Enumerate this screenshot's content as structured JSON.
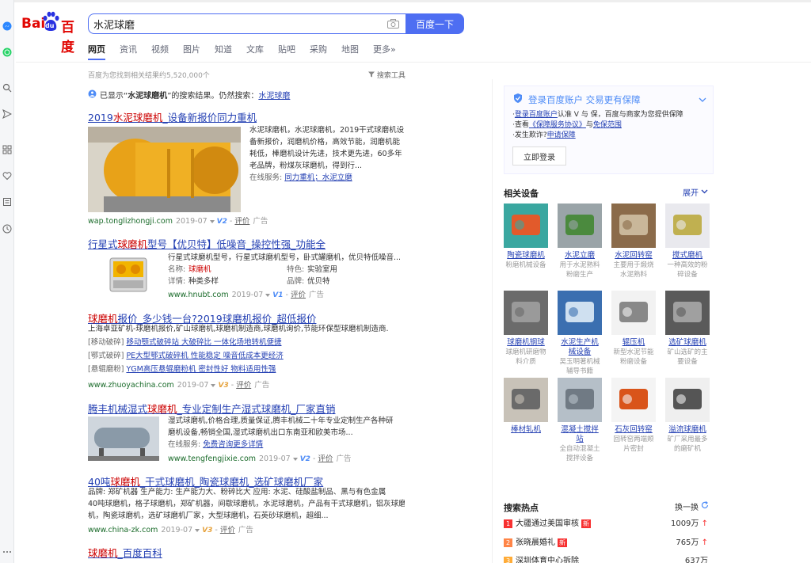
{
  "search": {
    "query": "水泥球磨",
    "button": "百度一下"
  },
  "logo": {
    "left": "Bai",
    "right": "百度",
    "paw": "du"
  },
  "tabs": [
    {
      "label": "网页",
      "active": true
    },
    {
      "label": "资讯"
    },
    {
      "label": "视频"
    },
    {
      "label": "图片"
    },
    {
      "label": "知道"
    },
    {
      "label": "文库"
    },
    {
      "label": "贴吧"
    },
    {
      "label": "采购"
    },
    {
      "label": "地图"
    },
    {
      "label": "更多»"
    }
  ],
  "result_count": "百度为您找到相关结果约5,520,000个",
  "search_tools": "搜索工具",
  "showing": {
    "prefix": "已显示“",
    "bold": "水泥球磨机",
    "mid": "”的搜索结果。仍然搜索：",
    "link": "水泥球磨"
  },
  "results": [
    {
      "title_pre": "2019",
      "title_red": "水泥球磨机",
      "title_post": "_设备新报价同力重机",
      "lines": [
        "水泥球磨机，水泥球磨机，2019干式球磨机设",
        "备新报价，润磨机价格，高效节能，润磨机能",
        "耗低，棒磨机设计先进，技术更先进，60多年",
        "老品牌，粉煤灰球磨机，得到行..."
      ],
      "service_label": "在线服务:",
      "service_link": "同力重机；水泥立磨",
      "url": "wap.tonglizhongji.com",
      "date": "2019-07",
      "v": "V2",
      "rating": "评价",
      "ad": "广告"
    },
    {
      "title_pre": "行星式",
      "title_red": "球磨机",
      "title_post": "型号【优贝特】低噪音_操控性强_功能全",
      "lines": [
        "行星式球磨机型号，行星式球磨机型号，卧式罐磨机，优贝特低噪音..."
      ],
      "fields": [
        {
          "label": "名称:",
          "value": "球磨机",
          "label2": "特色:",
          "value2": "实验室用"
        },
        {
          "label": "详情:",
          "value": "种类多样",
          "label2": "品牌:",
          "value2": "优贝特"
        }
      ],
      "url": "www.hnubt.com",
      "date": "2019-07",
      "v": "V1",
      "rating": "评价",
      "ad": "广告"
    },
    {
      "title_red": "球磨机",
      "title_post": "报价_多少钱一台?2019球磨机报价_超低报价",
      "lines": [
        "上海卓亚矿机-球磨机报价,矿山球磨机,球磨机制造商,球磨机询价,节能环保型球磨机制造商."
      ],
      "sublinks": [
        {
          "tag": "[移动破碎]",
          "text": "移动颚式破碎站 大破碎比 一体化场地转机便捷"
        },
        {
          "tag": "[鄂式破碎]",
          "text": "PE大型鄂式破碎机 性能稳定 噪音低成本更经济"
        },
        {
          "tag": "[悬辊磨粉]",
          "text": "YGM高压悬辊磨粉机 密封性好 物料适用性强"
        }
      ],
      "url": "www.zhuoyachina.com",
      "date": "2019-07",
      "v": "V3",
      "rating": "评价",
      "ad": "广告"
    },
    {
      "title_pre": "腾丰机械湿式",
      "title_red": "球磨机",
      "title_post": "_专业定制生产湿式球磨机_厂家直销",
      "lines": [
        "湿式球磨机,价格合理,质量保证,腾丰机械二十年专业定制生产各种研",
        "磨机设备,畅销全国,湿式球磨机出口东南亚和欧美市场..."
      ],
      "service_label": "在线服务:",
      "service_link": "免费咨询更多详情",
      "url": "www.tengfengjixie.com",
      "date": "2019-07",
      "v": "V2",
      "rating": "评价",
      "ad": "广告"
    },
    {
      "title_pre": "40吨",
      "title_red": "球磨机",
      "title_post": "_干式球磨机_陶瓷球磨机_选矿球磨机厂家",
      "lines": [
        "品牌: 郑矿机器    生产能力: 生产能力大、粉碎比大    应用: 水泥、硅酸盐制品、黑与有色金属",
        "40吨球磨机，格子球磨机，郑矿机器，间歇球磨机，水泥球磨机，产品有干式球磨机，铝灰球磨",
        "机，陶瓷球磨机，选矿球磨机厂家，大型球磨机，石英砂球磨机，超细..."
      ],
      "url": "www.china-zk.com",
      "date": "2019-07",
      "v": "V3",
      "rating": "评价",
      "ad": "广告"
    },
    {
      "title_red": "球磨机",
      "title_post": "_百度百科"
    }
  ],
  "login_card": {
    "title": "登录百度账户 交易更有保障",
    "items": [
      {
        "pre": "·",
        "link": "登录百度账户",
        "post": "认准 V 与 保，百度与商家为您提供保障"
      },
      {
        "pre": "·查看",
        "link": "《保障服务协议》",
        "mid": "与",
        "link2": "免保范围"
      },
      {
        "pre": "·发生欺诈?",
        "link": "申请保障"
      }
    ],
    "button": "立即登录"
  },
  "related": {
    "title": "相关设备",
    "expand": "展开",
    "items": [
      {
        "name": "陶瓷球磨机",
        "desc": "粉磨机械设备"
      },
      {
        "name": "水泥立磨",
        "desc": "用于水泥熟料粉磨生产"
      },
      {
        "name": "水泥回转窑",
        "desc": "主要用于煅烧水泥熟料"
      },
      {
        "name": "搅式磨机",
        "desc": "一种高效的粉碎设备"
      },
      {
        "name": "球磨机钢球",
        "desc": "球磨机研磨物料介质"
      },
      {
        "name": "水泥生产机械设备",
        "desc": "吴玉明著机械辅导书籍"
      },
      {
        "name": "辊压机",
        "desc": "新型水泥节能粉磨设备"
      },
      {
        "name": "选矿球磨机",
        "desc": "矿山选矿的主要设备"
      },
      {
        "name": "棒材轧机",
        "desc": ""
      },
      {
        "name": "混凝土搅拌站",
        "desc": "全自动混凝土搅拌设备"
      },
      {
        "name": "石灰回转窑",
        "desc": "回转窑两端颊片密封"
      },
      {
        "name": "溢流球磨机",
        "desc": "矿厂采用最多的磨矿机"
      }
    ]
  },
  "hot": {
    "title": "搜索热点",
    "refresh": "换一换",
    "items": [
      {
        "rank": "1",
        "text": "大疆通过美国审核",
        "badge": "新",
        "count": "1009万"
      },
      {
        "rank": "2",
        "text": "张晓晨婚礼",
        "badge": "新",
        "count": "765万"
      },
      {
        "rank": "3",
        "text": "深圳体育中心拆除",
        "badge": "",
        "count": "637万"
      }
    ]
  },
  "colors": {
    "accent": "#4e6ef2",
    "link": "#2440b3",
    "red": "#c00",
    "url": "#1a6b2a"
  }
}
